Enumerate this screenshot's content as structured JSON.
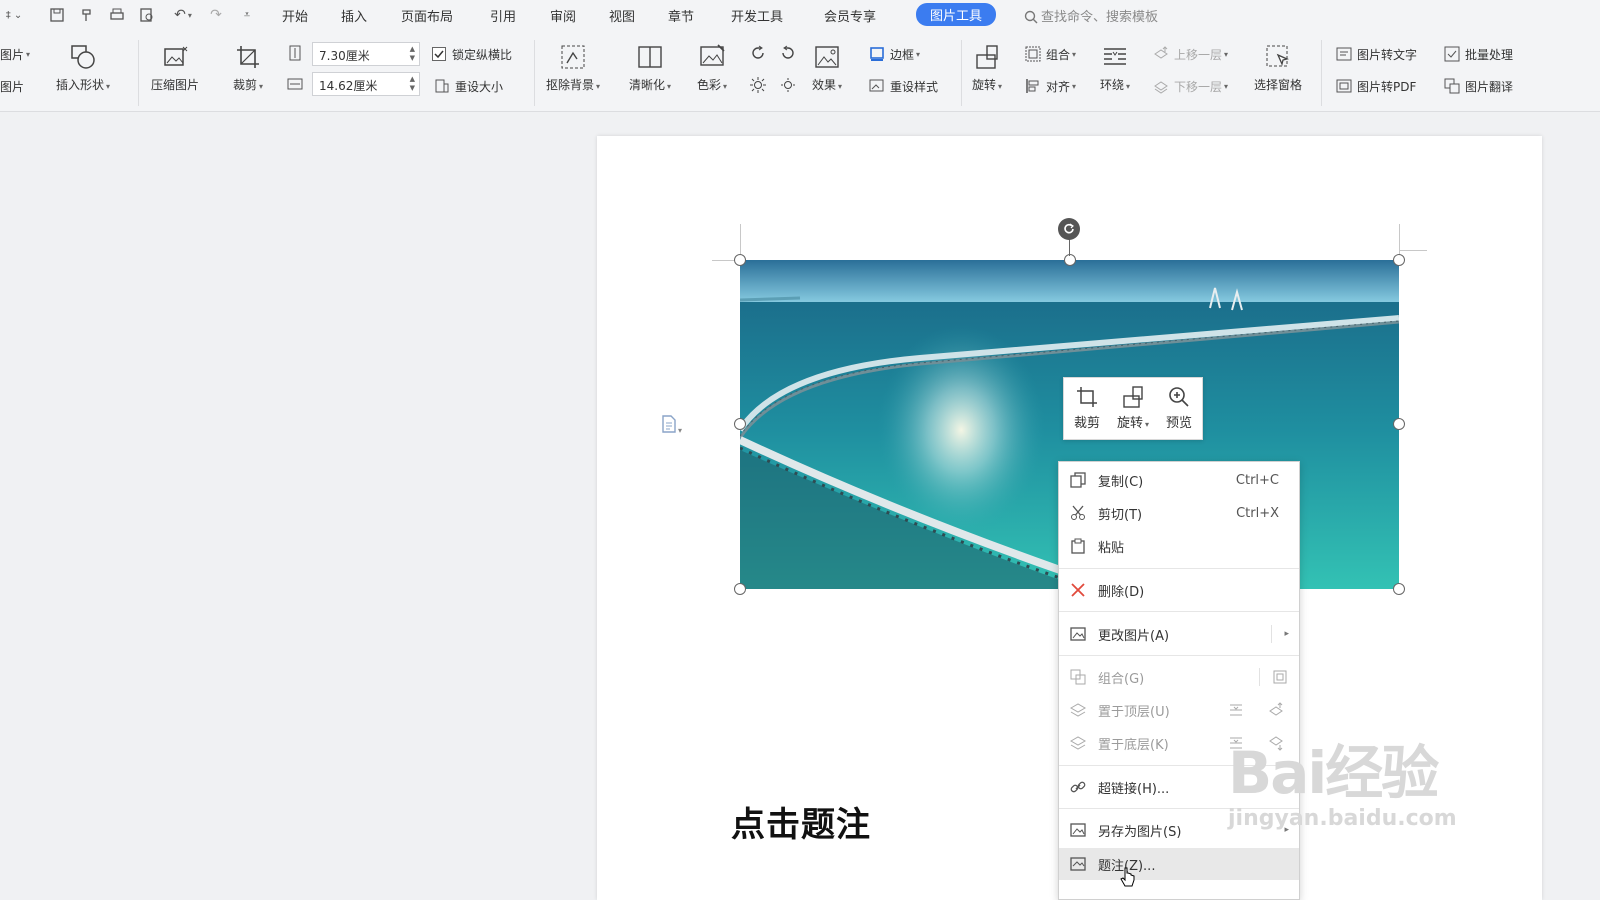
{
  "toolbar": {
    "menu_tabs": [
      "开始",
      "插入",
      "页面布局",
      "引用",
      "审阅",
      "视图",
      "章节",
      "开发工具",
      "会员专享"
    ],
    "active_tab": "图片工具",
    "search_placeholder": "查找命令、搜索模板"
  },
  "ribbon": {
    "left_cut_top": "图片",
    "left_cut_bottom": "图片",
    "insert_shape": "插入形状",
    "compress": "压缩图片",
    "crop": "裁剪",
    "height_value": "7.30厘米",
    "width_value": "14.62厘米",
    "lock_ratio": "锁定纵横比",
    "reset_size": "重设大小",
    "remove_bg": "抠除背景",
    "sharpen": "清晰化",
    "color": "色彩",
    "effects": "效果",
    "border": "边框",
    "reset_style": "重设样式",
    "rotate": "旋转",
    "group": "组合",
    "align": "对齐",
    "wrap": "环绕",
    "bring_forward": "上移一层",
    "send_backward": "下移一层",
    "selection_pane": "选择窗格",
    "img_to_text": "图片转文字",
    "batch": "批量处理",
    "img_to_pdf": "图片转PDF",
    "img_translate": "图片翻译"
  },
  "mini_toolbar": {
    "crop": "裁剪",
    "rotate": "旋转",
    "preview": "预览"
  },
  "context_menu": {
    "copy": "复制(C)",
    "copy_sc": "Ctrl+C",
    "cut": "剪切(T)",
    "cut_sc": "Ctrl+X",
    "paste": "粘贴",
    "delete": "删除(D)",
    "change_pic": "更改图片(A)",
    "group": "组合(G)",
    "bring_top": "置于顶层(U)",
    "send_bottom": "置于底层(K)",
    "hyperlink": "超链接(H)...",
    "save_as_pic": "另存为图片(S)",
    "caption": "题注(Z)..."
  },
  "overlay": {
    "caption_text": "点击题注",
    "watermark_top": "Bai经验",
    "watermark_bottom": "jingyan.baidu.com"
  },
  "colors": {
    "accent": "#3b7cf0",
    "sea_dark": "#0c5a76",
    "sea_light": "#36c0c0",
    "delete_red": "#e14a3c"
  }
}
